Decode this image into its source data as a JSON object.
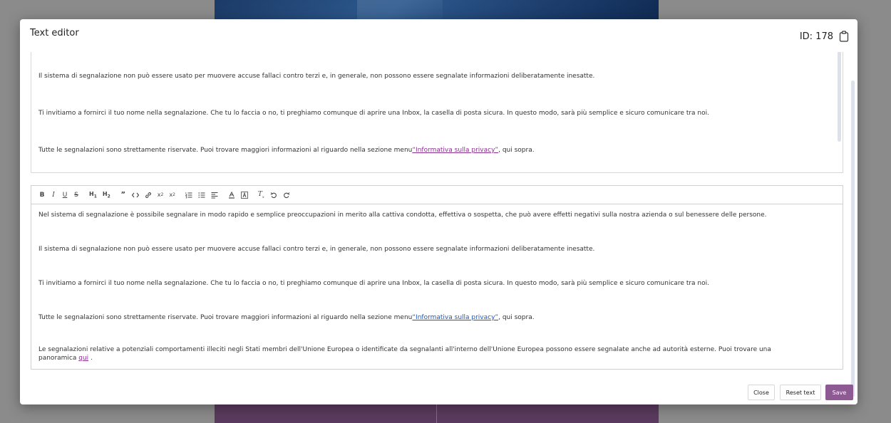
{
  "window": {
    "title": "Text editor",
    "id_label": "ID: 178"
  },
  "preview": {
    "paragraphs": [
      "Il sistema di segnalazione non può essere usato per muovere accuse fallaci contro terzi e, in generale, non possono essere segnalate informazioni deliberatamente inesatte.",
      "Ti invitiamo a fornirci il tuo nome nella segnalazione. Che tu lo faccia o no, ti preghiamo comunque di aprire una Inbox, la casella di posta sicura. In questo modo, sarà più semplice e sicuro comunicare tra noi."
    ],
    "privacy_pre": "Tutte le segnalazioni sono strettamente riservate. Puoi trovare maggiori informazioni al riguardo nella sezione menu",
    "privacy_link": "“Informativa sulla privacy”",
    "privacy_post": ", qui sopra."
  },
  "toolbar": {
    "buttons": [
      {
        "name": "bold-button",
        "label": "B"
      },
      {
        "name": "italic-button",
        "label": "I"
      },
      {
        "name": "underline-button",
        "label": "U"
      },
      {
        "name": "strikethrough-button",
        "label": "S"
      },
      {
        "name": "heading1-button",
        "label": "H1"
      },
      {
        "name": "heading2-button",
        "label": "H2"
      },
      {
        "name": "blockquote-button",
        "label": "quote"
      },
      {
        "name": "code-button",
        "label": "code"
      },
      {
        "name": "link-button",
        "label": "link"
      },
      {
        "name": "subscript-button",
        "label": "x₂"
      },
      {
        "name": "superscript-button",
        "label": "x²"
      },
      {
        "name": "ordered-list-button",
        "label": "ol"
      },
      {
        "name": "bullet-list-button",
        "label": "ul"
      },
      {
        "name": "align-button",
        "label": "align"
      },
      {
        "name": "text-color-button",
        "label": "A"
      },
      {
        "name": "background-color-button",
        "label": "A"
      },
      {
        "name": "clear-format-button",
        "label": "Tx"
      },
      {
        "name": "undo-button",
        "label": "undo"
      },
      {
        "name": "redo-button",
        "label": "redo"
      }
    ]
  },
  "editor": {
    "paragraphs": [
      "Nel sistema di segnalazione è possibile segnalare in modo rapido e semplice preoccupazioni in merito alla cattiva condotta, effettiva o sospetta, che può avere effetti negativi sulla nostra azienda o sul benessere delle persone.",
      "Il sistema di segnalazione non può essere usato per muovere accuse fallaci contro terzi e, in generale, non possono essere segnalate informazioni deliberatamente inesatte.",
      "Ti invitiamo a fornirci il tuo nome nella segnalazione. Che tu lo faccia o no, ti preghiamo comunque di aprire una Inbox, la casella di posta sicura. In questo modo, sarà più semplice e sicuro comunicare tra noi."
    ],
    "privacy_pre": "Tutte le segnalazioni sono strettamente riservate. Puoi trovare maggiori informazioni al riguardo nella sezione menu",
    "privacy_link": "“Informativa sulla privacy”",
    "privacy_post": ", qui sopra.",
    "eu_line1": "Le segnalazioni relative a potenziali comportamenti illeciti negli Stati membri dell'Unione Europea o identificate da segnalanti all'interno dell'Unione Europea possono essere segnalate anche ad autorità esterne. Puoi trovare una",
    "eu_line2_pre": "panoramica ",
    "eu_link": "qui",
    "eu_line2_post": " ."
  },
  "footer": {
    "close_label": "Close",
    "reset_label": "Reset text",
    "save_label": "Save"
  },
  "colors": {
    "primary": "#8e5a93",
    "link_purple": "#8a2f8f",
    "link_blue": "#1a56c4"
  }
}
